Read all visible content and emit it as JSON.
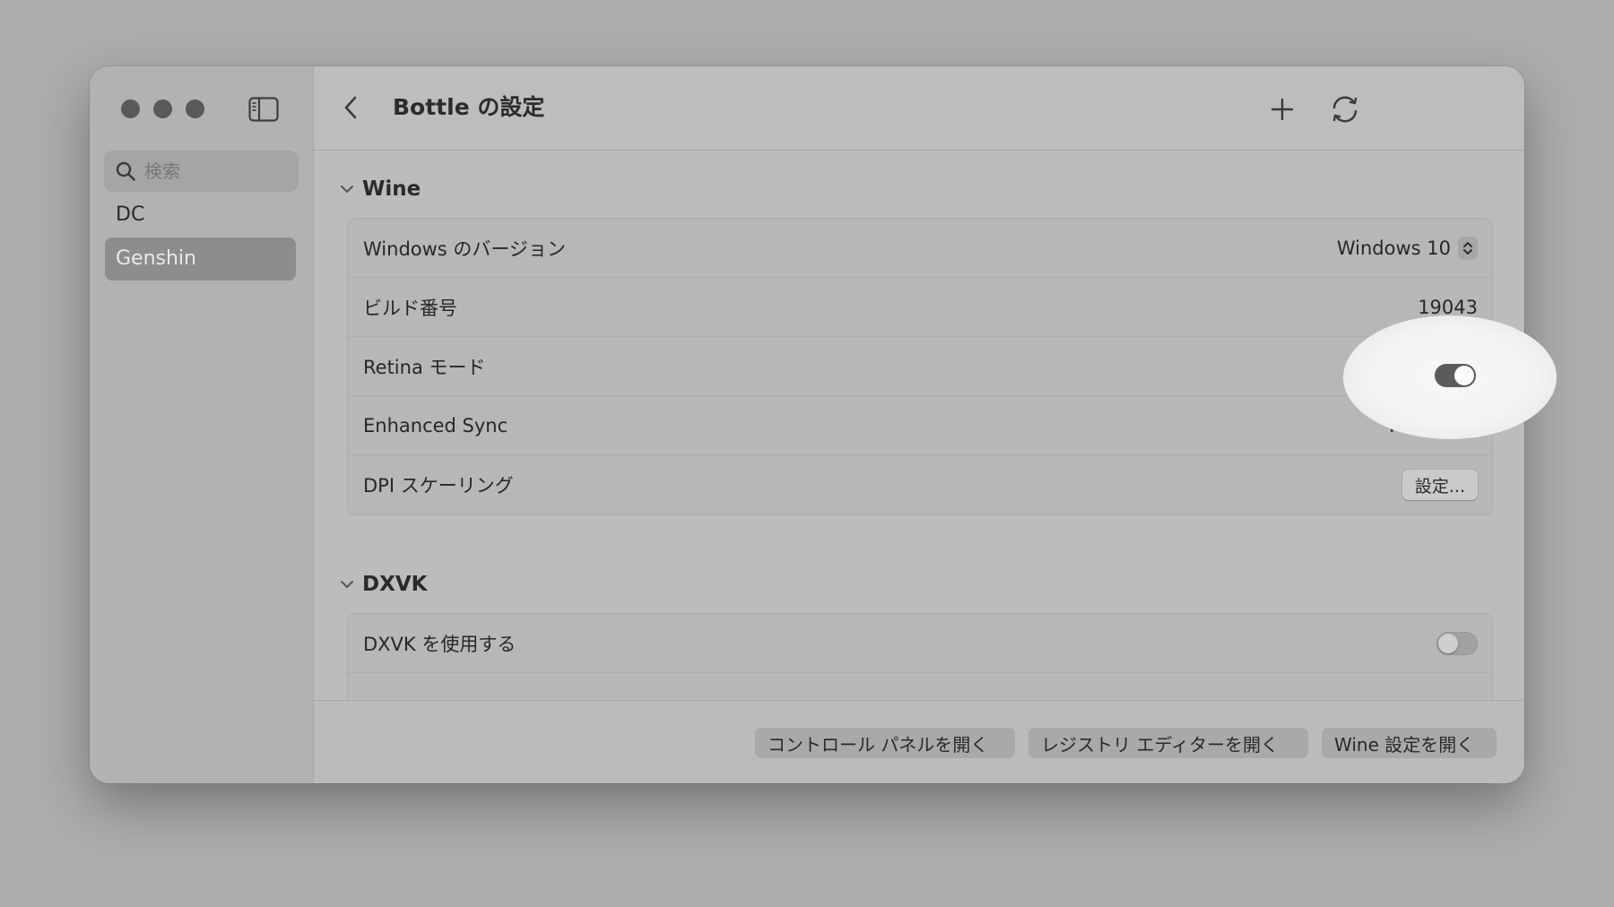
{
  "sidebar": {
    "search_placeholder": "検索",
    "items": [
      {
        "label": "DC",
        "selected": false
      },
      {
        "label": "Genshin",
        "selected": true
      }
    ]
  },
  "toolbar": {
    "title": "Bottle の設定"
  },
  "wine": {
    "section_label": "Wine",
    "windows_version": {
      "label": "Windows のバージョン",
      "value": "Windows 10"
    },
    "build_number": {
      "label": "ビルド番号",
      "value": "19043"
    },
    "retina_mode": {
      "label": "Retina モード",
      "enabled": true
    },
    "enhanced_sync": {
      "label": "Enhanced Sync",
      "value": "MSync"
    },
    "dpi_scaling": {
      "label": "DPI スケーリング",
      "button": "設定..."
    }
  },
  "dxvk": {
    "section_label": "DXVK",
    "use_dxvk": {
      "label": "DXVK を使用する",
      "enabled": false
    }
  },
  "footer": {
    "control_panel": "コントロール パネルを開く",
    "registry_editor": "レジストリ エディターを開く",
    "wine_config": "Wine 設定を開く"
  }
}
